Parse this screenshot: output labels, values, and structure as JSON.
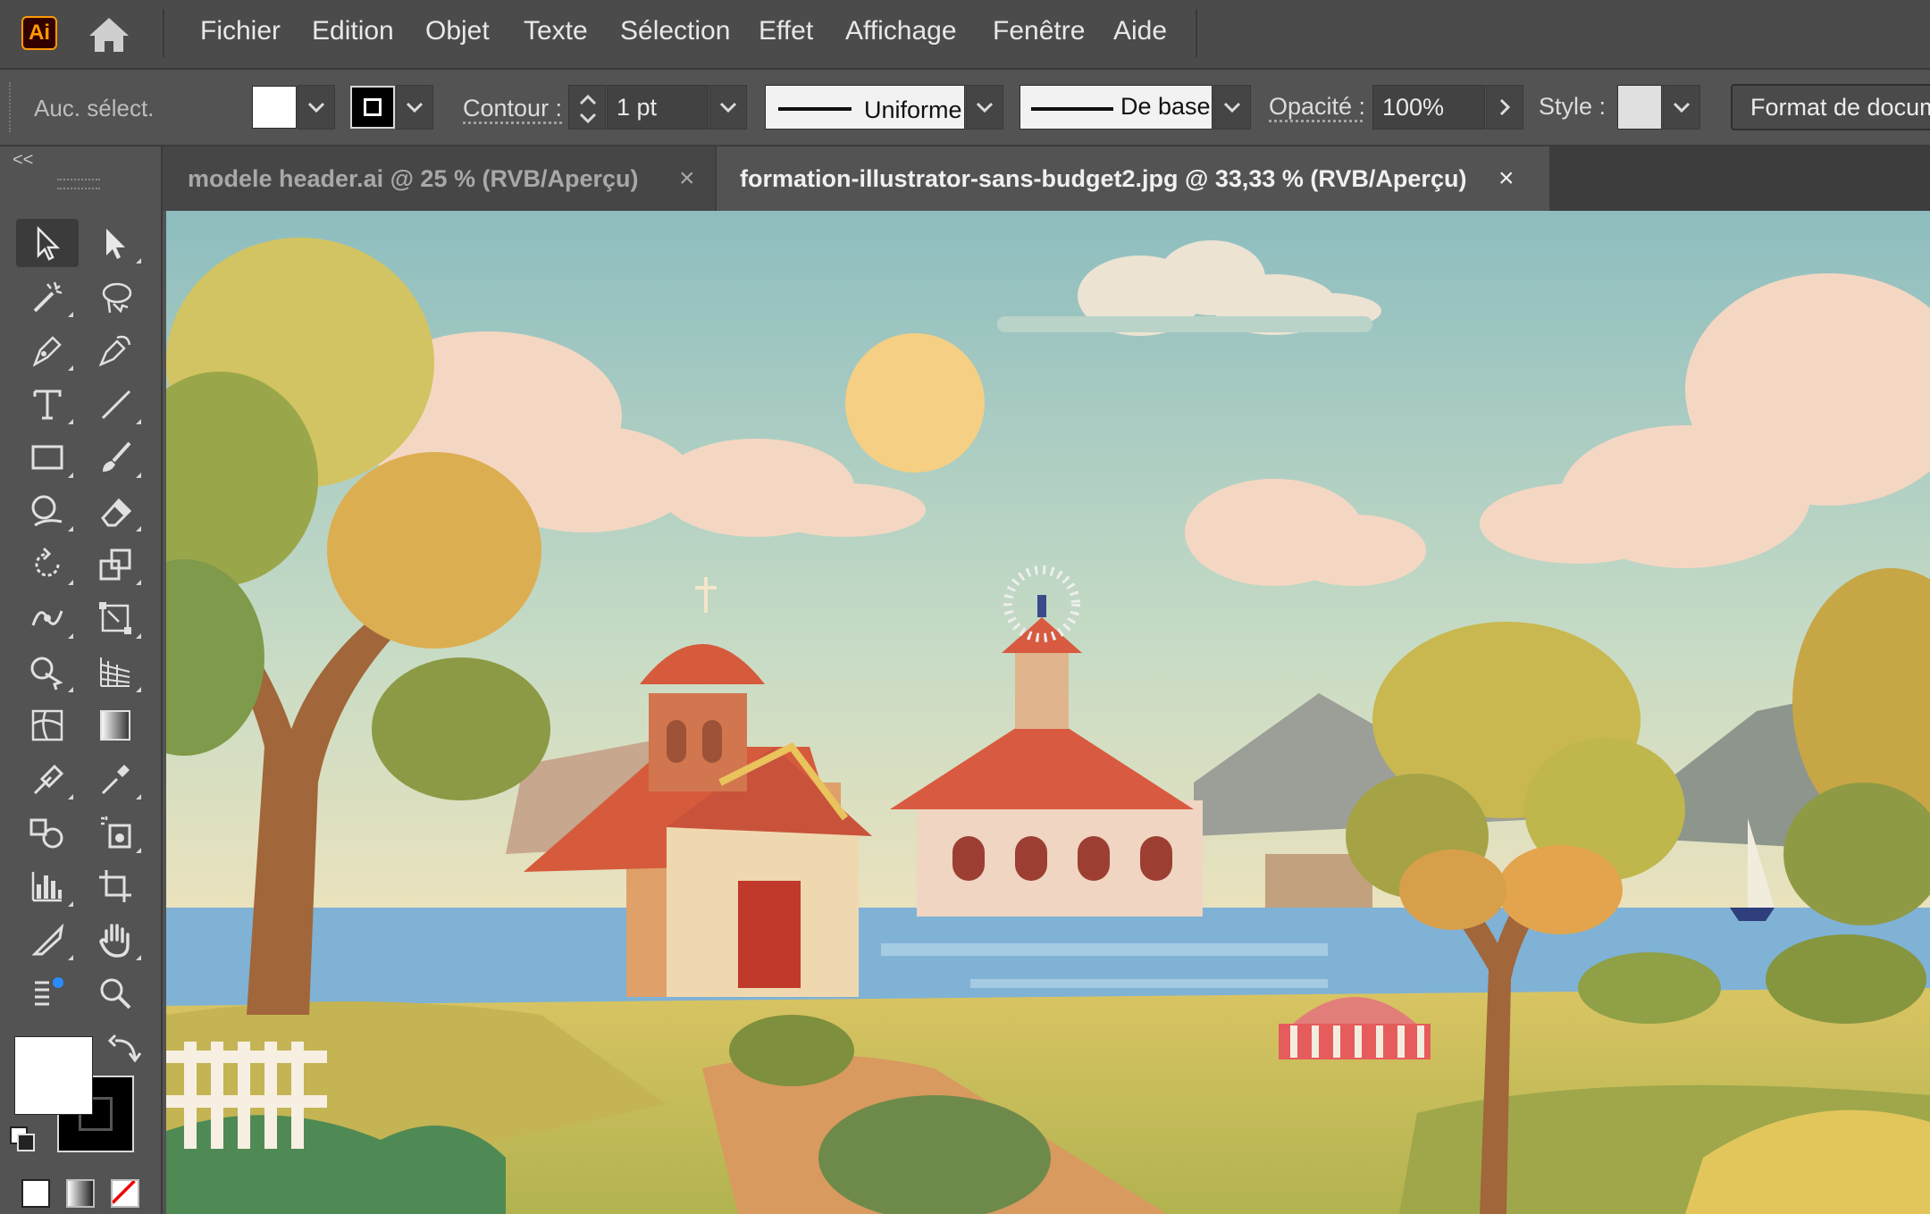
{
  "app": {
    "logo_text": "Ai"
  },
  "menu": [
    "Fichier",
    "Edition",
    "Objet",
    "Texte",
    "Sélection",
    "Effet",
    "Affichage",
    "Fenêtre",
    "Aide"
  ],
  "control": {
    "selection_status": "Auc. sélect.",
    "stroke_label": "Contour :",
    "stroke_weight": "1 pt",
    "variable_width_profile": "Uniforme",
    "brush": "De base",
    "opacity_label": "Opacité :",
    "opacity_value": "100%",
    "style_label": "Style :",
    "document_setup_button": "Format de document"
  },
  "tabs": [
    {
      "label": "modele header.ai @ 25 % (RVB/Aperçu)",
      "active": false,
      "close": "×"
    },
    {
      "label": "formation-illustrator-sans-budget2.jpg @ 33,33 % (RVB/Aperçu)",
      "active": true,
      "close": "×"
    }
  ],
  "toolbar": {
    "collapse_glyph": "<<",
    "tools": [
      "selection-tool",
      "direct-selection-tool",
      "magic-wand-tool",
      "lasso-tool",
      "pen-tool",
      "curvature-tool",
      "type-tool",
      "line-segment-tool",
      "rectangle-tool",
      "paintbrush-tool",
      "shaper-tool",
      "eraser-tool",
      "rotate-tool",
      "scale-tool",
      "width-tool",
      "free-transform-tool",
      "shape-builder-tool",
      "perspective-grid-tool",
      "mesh-tool",
      "gradient-tool",
      "eyedropper-tool",
      "eyedropper-measure-tool",
      "blend-tool",
      "symbol-sprayer-tool",
      "column-graph-tool",
      "artboard-tool",
      "slice-tool",
      "hand-tool",
      "toolbar-edit-tool",
      "zoom-tool"
    ]
  },
  "colors": {
    "fill": "#ffffff",
    "stroke": "#000000",
    "accent_logo": "#ff9a00"
  }
}
